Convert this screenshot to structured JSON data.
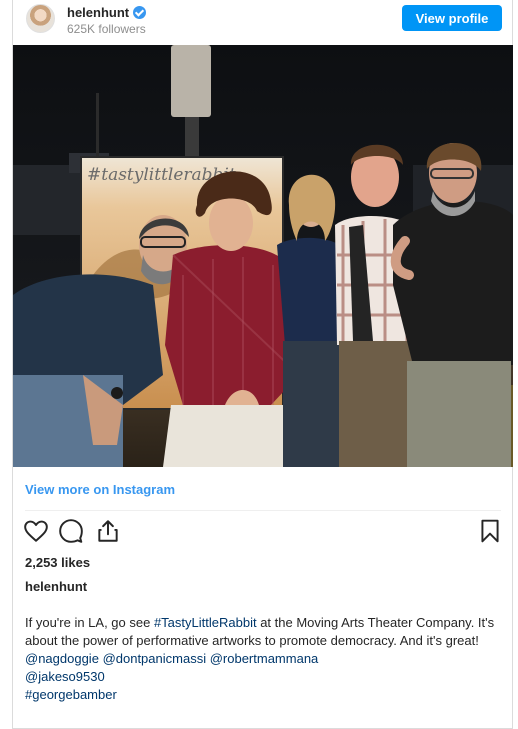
{
  "header": {
    "username": "helenhunt",
    "followers": "625K followers",
    "view_profile_label": "View profile"
  },
  "post": {
    "image_sign_text": "#tastylittlerabbit",
    "view_more_label": "View more on Instagram",
    "likes": "2,253 likes",
    "caption_username": "helenhunt",
    "caption": {
      "line1_prefix": "If you're in LA, go see ",
      "hashtag1": "#TastyLittleRabbit",
      "line1_suffix": " at the Moving Arts Theater Company. It's about the power of performative artworks to promote democracy. And it's great!",
      "mention1": "@nagdoggie",
      "mention2": "@dontpanicmassi",
      "mention3": "@robertmammana",
      "mention4": "@jakeso9530",
      "hashtag2": "#georgebamber"
    }
  },
  "icons": {
    "like": "heart-icon",
    "comment": "comment-icon",
    "share": "share-icon",
    "save": "bookmark-icon"
  },
  "colors": {
    "accent": "#0095f6",
    "link": "#3897f0",
    "hashtag": "#00376b",
    "verified": "#3897f0"
  }
}
